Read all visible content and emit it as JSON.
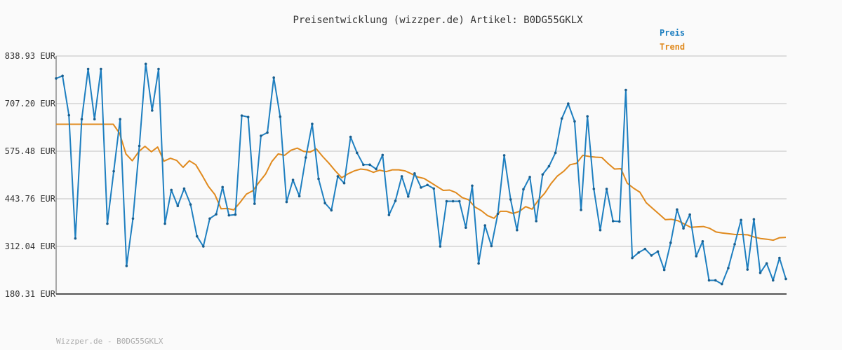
{
  "footer": "Wizzper.de - B0DG55GKLX",
  "colors": {
    "price": "#1e7fc0",
    "trend": "#e08a1e",
    "grid": "#dddddd",
    "axis": "#555555"
  },
  "chart_data": {
    "type": "line",
    "title": "Preisentwicklung (wizzper.de) Artikel: B0DG55GKLX",
    "ylim": [
      180.31,
      838.93
    ],
    "yticks": [
      "838.93 EUR",
      "707.20 EUR",
      "575.48 EUR",
      "443.76 EUR",
      "312.04 EUR",
      "180.31 EUR"
    ],
    "grid": true,
    "legend": "top-right",
    "series": [
      {
        "name": "Preis",
        "values": [
          777,
          784,
          675,
          334,
          664,
          803,
          664,
          803,
          375,
          520,
          664,
          258,
          389,
          590,
          817,
          688,
          803,
          375,
          468,
          424,
          472,
          428,
          340,
          312,
          389,
          401,
          476,
          398,
          400,
          674,
          670,
          430,
          618,
          627,
          779,
          671,
          435,
          496,
          451,
          558,
          651,
          499,
          432,
          412,
          506,
          487,
          615,
          571,
          538,
          538,
          526,
          565,
          399,
          438,
          506,
          450,
          514,
          475,
          482,
          472,
          312,
          437,
          437,
          437,
          364,
          480,
          265,
          370,
          313,
          402,
          564,
          442,
          357,
          470,
          504,
          382,
          511,
          534,
          571,
          666,
          707,
          658,
          413,
          672,
          471,
          357,
          471,
          382,
          381,
          745,
          280,
          295,
          305,
          287,
          298,
          247,
          322,
          414,
          362,
          400,
          285,
          326,
          218,
          218,
          208,
          252,
          318,
          385,
          248,
          387,
          239,
          265,
          218,
          280,
          222
        ],
        "color": "#1e7fc0"
      },
      {
        "name": "Trend",
        "values": [
          650,
          650,
          650,
          650,
          650,
          650,
          650,
          650,
          650,
          650,
          625,
          568,
          549,
          574,
          589,
          574,
          587,
          548,
          556,
          550,
          531,
          549,
          538,
          509,
          478,
          456,
          416,
          417,
          413,
          434,
          457,
          466,
          490,
          512,
          547,
          568,
          564,
          578,
          584,
          575,
          573,
          582,
          561,
          542,
          521,
          502,
          513,
          521,
          526,
          524,
          517,
          523,
          519,
          524,
          524,
          521,
          513,
          504,
          500,
          489,
          478,
          467,
          468,
          461,
          447,
          441,
          421,
          411,
          397,
          390,
          409,
          409,
          403,
          409,
          422,
          415,
          440,
          459,
          486,
          507,
          520,
          538,
          542,
          564,
          561,
          559,
          558,
          541,
          526,
          527,
          487,
          473,
          462,
          433,
          417,
          402,
          386,
          387,
          383,
          374,
          365,
          366,
          367,
          362,
          352,
          349,
          347,
          345,
          345,
          344,
          338,
          334,
          332,
          329,
          336,
          337
        ],
        "color": "#e08a1e"
      }
    ]
  }
}
